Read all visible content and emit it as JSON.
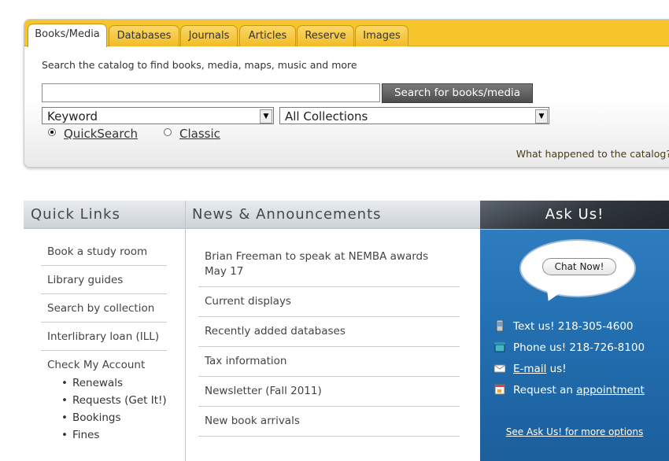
{
  "search": {
    "tabs": [
      "Books/Media",
      "Databases",
      "Journals",
      "Articles",
      "Reserve",
      "Images"
    ],
    "instructions": "Search the catalog to find books, media, maps, music and more",
    "input_value": "",
    "button_label": "Search for books/media",
    "search_type": "Keyword",
    "collection": "All Collections",
    "radio": {
      "quick": "QuickSearch",
      "classic": "Classic"
    },
    "what_happened": "What happened to the catalog?"
  },
  "quick_links": {
    "title": "Quick Links",
    "items": [
      "Book a study room",
      "Library guides",
      "Search by collection",
      "Interlibrary loan (ILL)",
      "Check My Account"
    ],
    "account_sub": [
      "Renewals",
      "Requests (Get It!)",
      "Bookings",
      "Fines"
    ]
  },
  "news": {
    "title": "News & Announcements",
    "items": [
      "Brian Freeman to speak at NEMBA awards May 17",
      "Current displays",
      "Recently added databases",
      "Tax information",
      "Newsletter (Fall 2011)",
      "New book arrivals"
    ]
  },
  "ask": {
    "title": "Ask Us!",
    "chat": "Chat Now!",
    "text": "Text us! 218-305-4600",
    "phone": "Phone us! 218-726-8100",
    "email_link": "E-mail",
    "email_rest": " us!",
    "request_prefix": "Request an ",
    "request_link": "appointment",
    "more": "See Ask Us! for more options"
  },
  "colors": {
    "tab_bar": "#f6c52b",
    "ask_blue": "#2370b2"
  }
}
